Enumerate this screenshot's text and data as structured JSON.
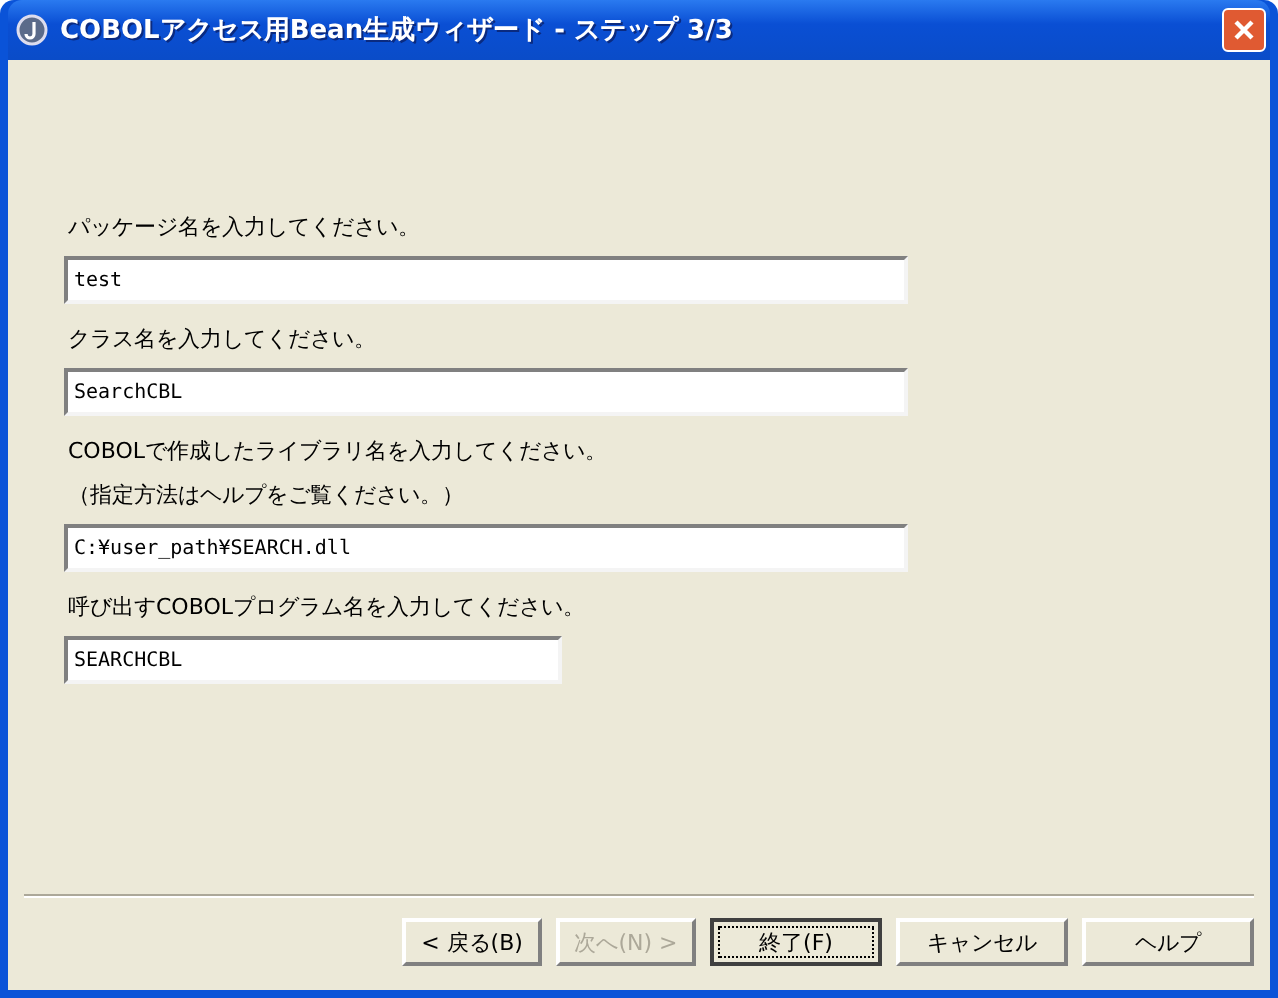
{
  "window": {
    "title": "COBOLアクセス用Bean生成ウィザード - ステップ 3/3"
  },
  "fields": [
    {
      "label_lines": [
        "パッケージ名を入力してください。"
      ],
      "value": "test",
      "kind": "wide"
    },
    {
      "label_lines": [
        "クラス名を入力してください。"
      ],
      "value": "SearchCBL",
      "kind": "wide"
    },
    {
      "label_lines": [
        "COBOLで作成したライブラリ名を入力してください。",
        "（指定方法はヘルプをご覧ください。）"
      ],
      "value": "C:¥user_path¥SEARCH.dll",
      "kind": "wide"
    },
    {
      "label_lines": [
        "呼び出すCOBOLプログラム名を入力してください。"
      ],
      "value": "SEARCHCBL",
      "kind": "narrow"
    }
  ],
  "buttons": [
    {
      "label": "< 戻る(B)",
      "disabled": false,
      "focused": false
    },
    {
      "label": "次へ(N) >",
      "disabled": true,
      "focused": false
    },
    {
      "label": "終了(F)",
      "disabled": false,
      "focused": true
    },
    {
      "label": "キャンセル",
      "disabled": false,
      "focused": false
    },
    {
      "label": "ヘルプ",
      "disabled": false,
      "focused": false
    }
  ]
}
